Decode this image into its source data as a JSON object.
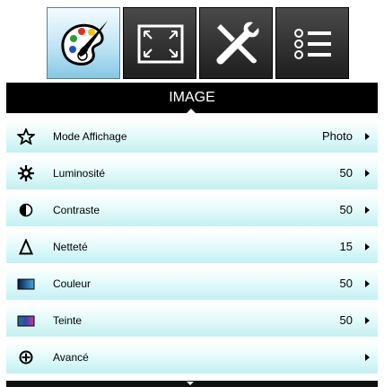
{
  "tabs": [
    {
      "name": "image-tab",
      "icon": "palette-brush-icon",
      "active": true
    },
    {
      "name": "display-tab",
      "icon": "screen-resize-icon",
      "active": false
    },
    {
      "name": "setup-tab",
      "icon": "tools-icon",
      "active": false
    },
    {
      "name": "options-tab",
      "icon": "list-icon",
      "active": false
    }
  ],
  "title": "IMAGE",
  "rows": [
    {
      "label": "Mode Affichage",
      "value": "Photo",
      "icon": "star-icon"
    },
    {
      "label": "Luminosité",
      "value": "50",
      "icon": "brightness-icon"
    },
    {
      "label": "Contraste",
      "value": "50",
      "icon": "contrast-icon"
    },
    {
      "label": "Netteté",
      "value": "15",
      "icon": "sharpness-icon"
    },
    {
      "label": "Couleur",
      "value": "50",
      "icon": "color-icon"
    },
    {
      "label": "Teinte",
      "value": "50",
      "icon": "tint-icon"
    },
    {
      "label": "Avancé",
      "value": "",
      "icon": "advanced-icon"
    }
  ],
  "colors": {
    "highlight": "#c4f0f2",
    "bar": "#000000",
    "active_tab": "#bfe5f5"
  }
}
